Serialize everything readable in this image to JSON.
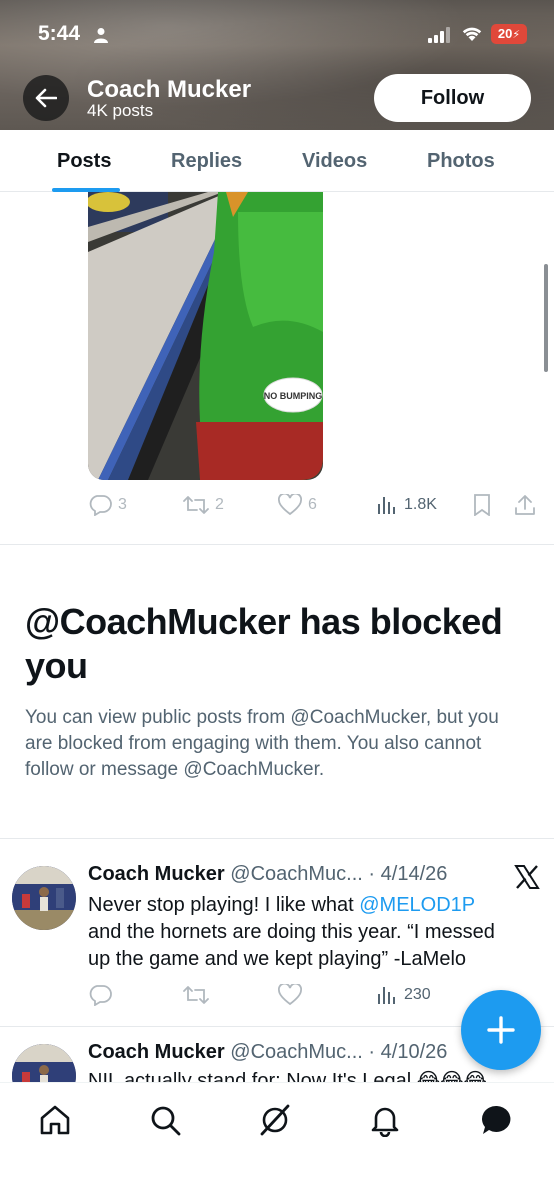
{
  "status_bar": {
    "time": "5:44",
    "battery": "20"
  },
  "header": {
    "name": "Coach Mucker",
    "post_count": "4K posts",
    "follow_label": "Follow"
  },
  "tabs": [
    {
      "label": "Posts"
    },
    {
      "label": "Replies"
    },
    {
      "label": "Videos"
    },
    {
      "label": "Photos"
    }
  ],
  "media_post": {
    "sticker_text": "NO BUMPING",
    "replies": "3",
    "reposts": "2",
    "likes": "6",
    "views": "1.8K"
  },
  "blocked": {
    "title": "@CoachMucker has blocked you",
    "text": "You can view public posts from @CoachMucker, but you are blocked from engaging with them. You also cannot follow or message @CoachMucker."
  },
  "tweets": [
    {
      "name": "Coach Mucker",
      "handle": "@CoachMuc...",
      "date": "· 4/14/26",
      "text_before": "Never stop playing! I like what ",
      "mention": "@MELOD1P",
      "text_after": " and the hornets are doing this year. “I messed up the game and we kept playing” -LaMelo",
      "views": "230"
    },
    {
      "name": "Coach Mucker",
      "handle": "@CoachMuc...",
      "date": "· 4/10/26",
      "text": "NIL actually stand for: Now It's Legal 😂😂😂"
    }
  ],
  "colors": {
    "accent": "#1d9bf0",
    "text": "#0f1419",
    "muted": "#536471"
  },
  "icons": {
    "bottom_nav": [
      "home-icon",
      "search-icon",
      "grok-icon",
      "notifications-icon",
      "messages-icon"
    ]
  }
}
